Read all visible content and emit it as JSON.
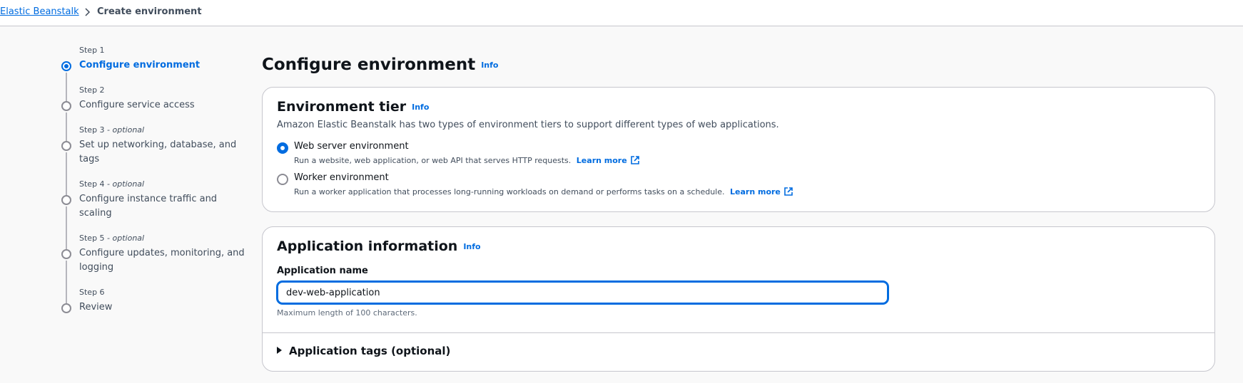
{
  "breadcrumb": {
    "root": "Elastic Beanstalk",
    "current": "Create environment"
  },
  "steps": [
    {
      "number": "Step 1",
      "optional": "",
      "title": "Configure environment",
      "active": true
    },
    {
      "number": "Step 2",
      "optional": "",
      "title": "Configure service access",
      "active": false
    },
    {
      "number": "Step 3",
      "optional": " - optional",
      "title": "Set up networking, database, and tags",
      "active": false
    },
    {
      "number": "Step 4",
      "optional": " - optional",
      "title": "Configure instance traffic and scaling",
      "active": false
    },
    {
      "number": "Step 5",
      "optional": " - optional",
      "title": "Configure updates, monitoring, and logging",
      "active": false
    },
    {
      "number": "Step 6",
      "optional": "",
      "title": "Review",
      "active": false
    }
  ],
  "main": {
    "title": "Configure environment",
    "info": "Info"
  },
  "environment_tier": {
    "title": "Environment tier",
    "info": "Info",
    "description": "Amazon Elastic Beanstalk has two types of environment tiers to support different types of web applications.",
    "options": [
      {
        "label": "Web server environment",
        "description": "Run a website, web application, or web API that serves HTTP requests.",
        "learn_more": "Learn more",
        "selected": true
      },
      {
        "label": "Worker environment",
        "description": "Run a worker application that processes long-running workloads on demand or performs tasks on a schedule.",
        "learn_more": "Learn more",
        "selected": false
      }
    ]
  },
  "application_information": {
    "title": "Application information",
    "info": "Info",
    "name_label": "Application name",
    "name_value": "dev-web-application",
    "constraint": "Maximum length of 100 characters.",
    "tags_expander": "Application tags (optional)"
  },
  "colors": {
    "accent": "#006ce0",
    "text": "#0f141a",
    "secondary_text": "#414d5c",
    "border": "#c6c6cd"
  }
}
